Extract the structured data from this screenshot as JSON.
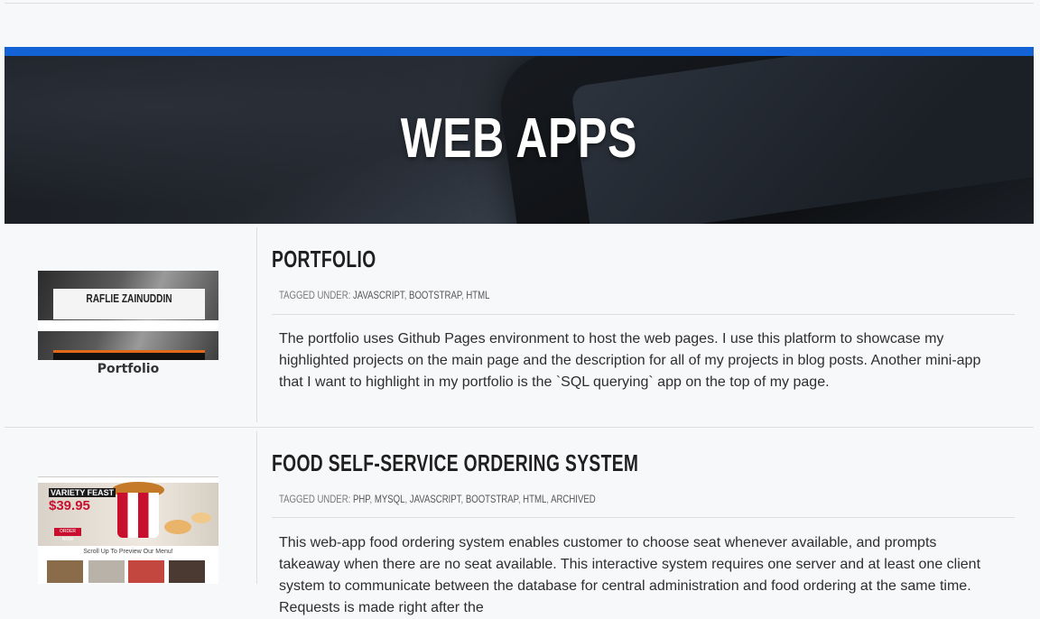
{
  "hero": {
    "title": "WEB APPS"
  },
  "items": [
    {
      "thumbnail_caption": "Portfolio",
      "thumbnail_text": "RAFLIE ZAINUDDIN",
      "title": "PORTFOLIO",
      "tags_prefix": "TAGGED UNDER:",
      "tags": [
        "JAVASCRIPT",
        "BOOTSTRAP",
        "HTML"
      ],
      "description": "The portfolio uses Github Pages environment to host the web pages. I use this platform to showcase my highlighted projects on the main page and the description for all of my projects in blog posts. Another mini-app that I want to highlight in my portfolio is the `SQL querying` app on the top of my page."
    },
    {
      "thumbnail_caption": "",
      "thumbnail_text": "VARIETY FEAST",
      "thumbnail_price": "$39.95",
      "thumbnail_cta": "ORDER NOW",
      "thumbnail_scroll": "Scroll Up To Preview Our Menu!",
      "title": "FOOD SELF-SERVICE ORDERING SYSTEM",
      "tags_prefix": "TAGGED UNDER:",
      "tags": [
        "PHP",
        "MYSQL",
        "JAVASCRIPT",
        "BOOTSTRAP",
        "HTML",
        "ARCHIVED"
      ],
      "description": "This web-app food ordering system enables customer to choose seat whenever available, and prompts takeaway when there are no seat available. This interactive system requires one server and at least one client system to communicate between the database for central administration and food ordering at the same time. Requests is made right after the"
    }
  ],
  "icons": {
    "hero_dots": "blackberry-logo-icon"
  },
  "colors": {
    "accent": "#1463d6",
    "hero_bg": "#1f232a"
  }
}
